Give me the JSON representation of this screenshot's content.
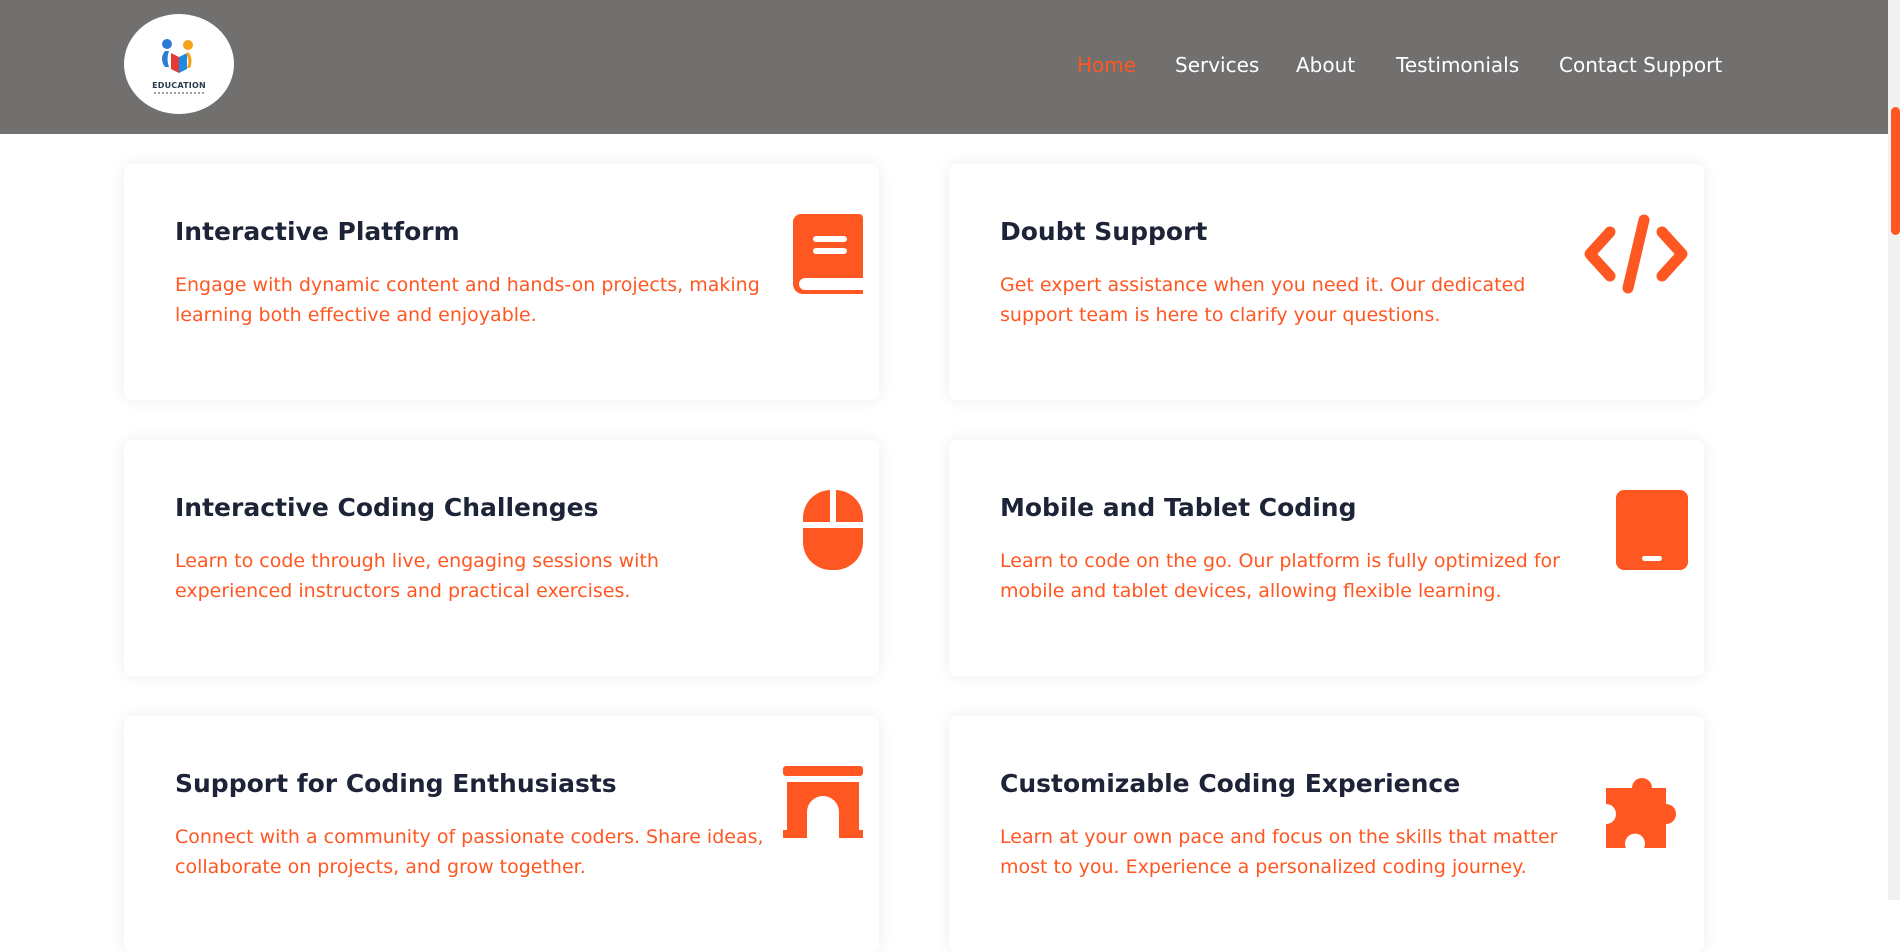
{
  "brand": {
    "name": "EDUCATION",
    "colors": {
      "accent": "#ff5722",
      "header": "#72706f",
      "heading": "#1e2437"
    }
  },
  "nav": {
    "items": [
      {
        "label": "Home",
        "active": true
      },
      {
        "label": "Services",
        "active": false
      },
      {
        "label": "About",
        "active": false
      },
      {
        "label": "Testimonials",
        "active": false
      },
      {
        "label": "Contact Support",
        "active": false
      }
    ]
  },
  "features": [
    {
      "title": "Interactive Platform",
      "description": "Engage with dynamic content and hands-on projects, making learning both effective and enjoyable.",
      "icon": "book-icon"
    },
    {
      "title": "Doubt Support",
      "description": "Get expert assistance when you need it. Our dedicated support team is here to clarify your questions.",
      "icon": "code-icon"
    },
    {
      "title": "Interactive Coding Challenges",
      "description": "Learn to code through live, engaging sessions with experienced instructors and practical exercises.",
      "icon": "mouse-icon"
    },
    {
      "title": "Mobile and Tablet Coding",
      "description": "Learn to code on the go. Our platform is fully optimized for mobile and tablet devices, allowing flexible learning.",
      "icon": "tablet-icon"
    },
    {
      "title": "Support for Coding Enthusiasts",
      "description": "Connect with a community of passionate coders. Share ideas, collaborate on projects, and grow together.",
      "icon": "archway-icon"
    },
    {
      "title": "Customizable Coding Experience",
      "description": "Learn at your own pace and focus on the skills that matter most to you. Experience a personalized coding journey.",
      "icon": "puzzle-piece-icon"
    }
  ]
}
